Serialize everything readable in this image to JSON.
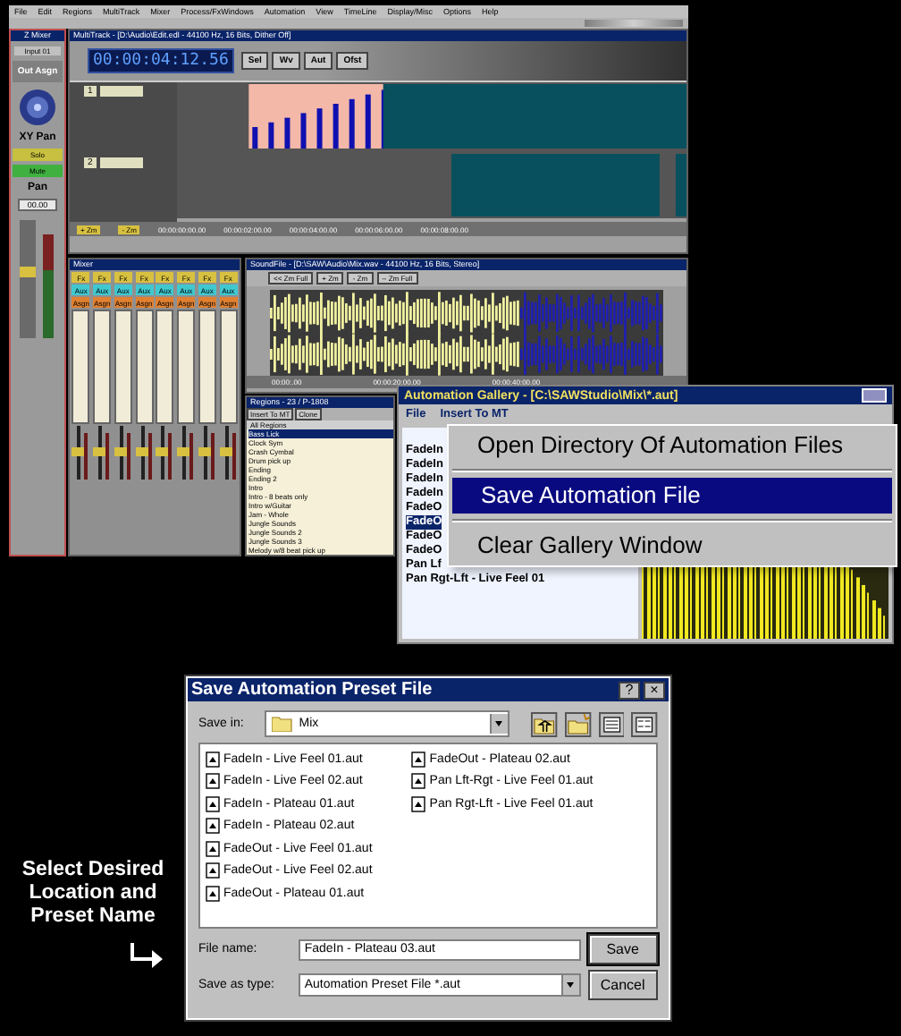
{
  "app": {
    "menu": [
      "File",
      "Edit",
      "Regions",
      "MultiTrack",
      "Mixer",
      "Process/FxWindows",
      "Automation",
      "View",
      "TimeLine",
      "Display/Misc",
      "Options",
      "Help"
    ],
    "zmixer": {
      "title": "Z Mixer",
      "input": "Input 01",
      "out_assign": "Out Asgn",
      "xy_pan": "XY Pan",
      "solo": "Solo",
      "mute": "Mute",
      "pan": "Pan",
      "readout": "00.00"
    },
    "multitrack": {
      "title": "MultiTrack - [D:\\Audio\\Edit.edl - 44100 Hz, 16 Bits, Dither Off]",
      "time": "00:00:04:12.56",
      "buttons": [
        "Sel",
        "Wv",
        "Aut",
        "Ofst"
      ],
      "tracks": [
        "1",
        "2"
      ],
      "zoom_buttons": [
        "+ Zm",
        "- Zm"
      ],
      "times": [
        "00:00:00:00.00",
        "00:00:02:00.00",
        "00:00:04:00.00",
        "00:00:06:00.00",
        "00:00:08:00.00"
      ]
    },
    "mixer": {
      "title": "Mixer",
      "channels": [
        {
          "buttons": [
            "Fx",
            "Aux",
            "Asgn"
          ]
        },
        {
          "buttons": [
            "Fx",
            "Aux",
            "Asgn"
          ]
        },
        {
          "buttons": [
            "Fx",
            "Aux",
            "Asgn"
          ]
        },
        {
          "buttons": [
            "Fx",
            "Aux",
            "Asgn"
          ]
        },
        {
          "buttons": [
            "Fx",
            "Aux",
            "Asgn"
          ]
        },
        {
          "buttons": [
            "Fx",
            "Aux",
            "Asgn"
          ]
        },
        {
          "buttons": [
            "Fx",
            "Aux",
            "Asgn"
          ]
        },
        {
          "buttons": [
            "Fx",
            "Aux",
            "Asgn"
          ]
        }
      ]
    },
    "soundfile": {
      "title": "SoundFile - [D:\\SAW\\Audio\\Mix.wav - 44100 Hz, 16 Bits, Stereo]",
      "buttons": [
        "<< Zm Full",
        "+ Zm",
        "- Zm",
        "-- Zm Full"
      ],
      "times": [
        "00:00:.00",
        "00:00:20:00.00",
        "00:00:40:00.00"
      ]
    },
    "regions": {
      "title": "Regions - 23 / P-1808",
      "buttons": [
        "Insert To MT",
        "Clone"
      ],
      "header": "All Regions",
      "items": [
        {
          "label": "Bass Lick",
          "selected": true
        },
        {
          "label": "Clock Sym",
          "selected": false
        },
        {
          "label": "Crash Cymbal",
          "selected": false
        },
        {
          "label": "Drum pick up",
          "selected": false
        },
        {
          "label": "Ending",
          "selected": false
        },
        {
          "label": "Ending 2",
          "selected": false
        },
        {
          "label": "Intro",
          "selected": false
        },
        {
          "label": "Intro - 8 beats only",
          "selected": false
        },
        {
          "label": "Intro w/Guitar",
          "selected": false
        },
        {
          "label": "Jam - Whole",
          "selected": false
        },
        {
          "label": "Jungle Sounds",
          "selected": false
        },
        {
          "label": "Jungle Sounds 2",
          "selected": false
        },
        {
          "label": "Jungle Sounds 3",
          "selected": false
        },
        {
          "label": "Melody w/8 beat pick up",
          "selected": false
        }
      ]
    }
  },
  "automation_gallery": {
    "title": "Automation Gallery - [C:\\SAWStudio\\Mix\\*.aut]",
    "menu": [
      "File",
      "Insert To MT"
    ],
    "items": [
      {
        "label": "FadeIn",
        "selected": false
      },
      {
        "label": "FadeIn",
        "selected": false
      },
      {
        "label": "FadeIn",
        "selected": false
      },
      {
        "label": "FadeIn",
        "selected": false
      },
      {
        "label": "FadeO",
        "selected": false
      },
      {
        "label": "FadeO",
        "selected": true
      },
      {
        "label": "FadeO",
        "selected": false
      },
      {
        "label": "FadeO",
        "selected": false
      },
      {
        "label": "Pan Lf",
        "selected": false
      },
      {
        "label": "Pan Rgt-Lft - Live Feel 01",
        "selected": false
      }
    ]
  },
  "context_menu": {
    "items": [
      {
        "label": "Open Directory Of Automation Files",
        "selected": false
      },
      {
        "label": "Save Automation File",
        "selected": true
      },
      {
        "label": "Clear Gallery Window",
        "selected": false
      }
    ]
  },
  "caption": "Select Desired Location and Preset Name",
  "dialog": {
    "title": "Save Automation Preset File",
    "help": "?",
    "close": "×",
    "save_in_label": "Save in:",
    "save_in": "Mix",
    "files": [
      "FadeIn - Live Feel 01.aut",
      "FadeIn - Live Feel 02.aut",
      "FadeIn - Plateau 01.aut",
      "FadeIn - Plateau 02.aut",
      "FadeOut - Live Feel 01.aut",
      "FadeOut - Live Feel 02.aut",
      "FadeOut - Plateau 01.aut",
      "FadeOut - Plateau 02.aut",
      "Pan Lft-Rgt - Live Feel 01.aut",
      "Pan Rgt-Lft - Live Feel 01.aut"
    ],
    "file_name_label": "File name:",
    "file_name": "FadeIn - Plateau 03.aut",
    "type_label": "Save as type:",
    "type": "Automation Preset File  *.aut",
    "save": "Save",
    "cancel": "Cancel"
  }
}
